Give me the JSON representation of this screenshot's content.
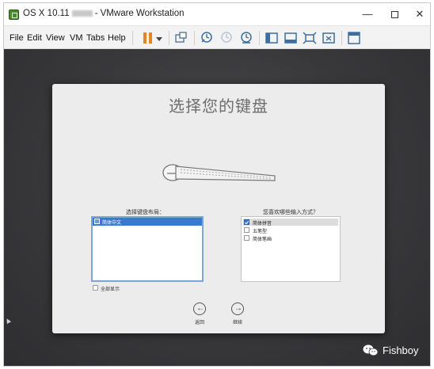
{
  "window": {
    "title_prefix": "OS X 10.11",
    "title_suffix": "- VMware Workstation",
    "minimize": "—",
    "close": "✕"
  },
  "menu": {
    "items": [
      "File",
      "Edit",
      "View",
      "VM",
      "Tabs",
      "Help"
    ]
  },
  "toolbar": {
    "icons": [
      "pause-icon",
      "dropdown-icon",
      "send-keys-icon",
      "snapshot-icon",
      "revert-snapshot-icon",
      "snapshot-manager-icon",
      "console-view-icon",
      "fullscreen-icon",
      "unity-icon",
      "stretch-icon",
      "library-icon"
    ]
  },
  "setup": {
    "title": "选择您的键盘",
    "layout_label": "选择键盘布局：",
    "layout_items": [
      {
        "label": "简体中文",
        "selected": true
      }
    ],
    "method_label": "您喜欢哪些输入方式？",
    "methods": [
      {
        "label": "简体拼音",
        "checked": true
      },
      {
        "label": "五笔型",
        "checked": false
      },
      {
        "label": "简体笔画",
        "checked": false
      }
    ],
    "show_all": "全部显示",
    "back": "返回",
    "continue": "继续"
  },
  "watermark": {
    "text": "Fishboy"
  },
  "colors": {
    "accent": "#3b79d1",
    "vm_background": "#3b3b3e",
    "pause": "#e8861a"
  }
}
